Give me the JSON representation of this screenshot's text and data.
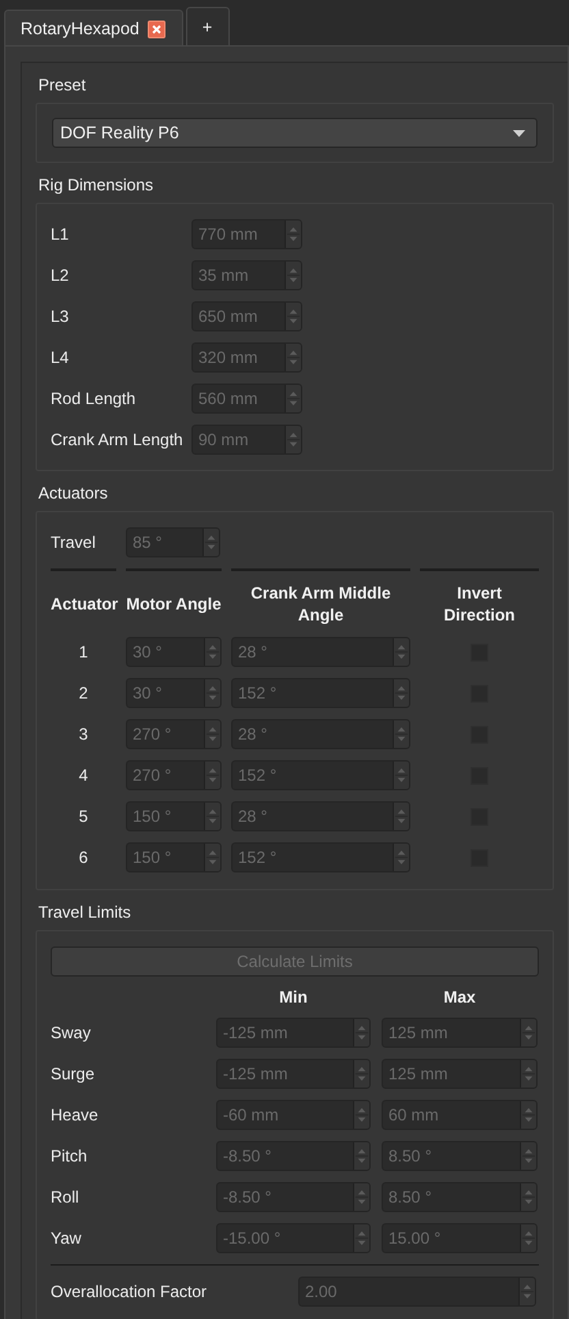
{
  "tabs": [
    {
      "label": "RotaryHexapod",
      "selected": true,
      "closable": true
    },
    {
      "label": "+",
      "selected": false,
      "closable": false
    }
  ],
  "preset": {
    "title": "Preset",
    "value": "DOF Reality P6"
  },
  "rig_dimensions": {
    "title": "Rig Dimensions",
    "fields": [
      {
        "label": "L1",
        "value": "770 mm",
        "disabled": true
      },
      {
        "label": "L2",
        "value": "35 mm",
        "disabled": true
      },
      {
        "label": "L3",
        "value": "650 mm",
        "disabled": true
      },
      {
        "label": "L4",
        "value": "320 mm",
        "disabled": true
      },
      {
        "label": "Rod Length",
        "value": "560 mm",
        "disabled": true
      },
      {
        "label": "Crank Arm Length",
        "value": "90 mm",
        "disabled": true
      }
    ]
  },
  "actuators": {
    "title": "Actuators",
    "travel": {
      "label": "Travel",
      "value": "85 °",
      "disabled": true
    },
    "columns": [
      "Actuator",
      "Motor Angle",
      "Crank Arm Middle Angle",
      "Invert Direction"
    ],
    "rows": [
      {
        "number": "1",
        "motor_angle": "30 °",
        "crank_arm_middle_angle": "28 °",
        "invert_direction": false,
        "disabled": true
      },
      {
        "number": "2",
        "motor_angle": "30 °",
        "crank_arm_middle_angle": "152 °",
        "invert_direction": false,
        "disabled": true
      },
      {
        "number": "3",
        "motor_angle": "270 °",
        "crank_arm_middle_angle": "28 °",
        "invert_direction": false,
        "disabled": true
      },
      {
        "number": "4",
        "motor_angle": "270 °",
        "crank_arm_middle_angle": "152 °",
        "invert_direction": false,
        "disabled": true
      },
      {
        "number": "5",
        "motor_angle": "150 °",
        "crank_arm_middle_angle": "28 °",
        "invert_direction": false,
        "disabled": true
      },
      {
        "number": "6",
        "motor_angle": "150 °",
        "crank_arm_middle_angle": "152 °",
        "invert_direction": false,
        "disabled": true
      }
    ]
  },
  "travel_limits": {
    "title": "Travel Limits",
    "calculate_button": {
      "label": "Calculate Limits",
      "disabled": true
    },
    "columns": [
      "Min",
      "Max"
    ],
    "rows": [
      {
        "label": "Sway",
        "min": "-125 mm",
        "max": "125 mm",
        "disabled": true
      },
      {
        "label": "Surge",
        "min": "-125 mm",
        "max": "125 mm",
        "disabled": true
      },
      {
        "label": "Heave",
        "min": "-60 mm",
        "max": "60 mm",
        "disabled": true
      },
      {
        "label": "Pitch",
        "min": "-8.50 °",
        "max": "8.50 °",
        "disabled": true
      },
      {
        "label": "Roll",
        "min": "-8.50 °",
        "max": "8.50 °",
        "disabled": true
      },
      {
        "label": "Yaw",
        "min": "-15.00 °",
        "max": "15.00 °",
        "disabled": true
      }
    ],
    "overallocation": {
      "label": "Overallocation Factor",
      "value": "2.00",
      "disabled": true
    }
  }
}
